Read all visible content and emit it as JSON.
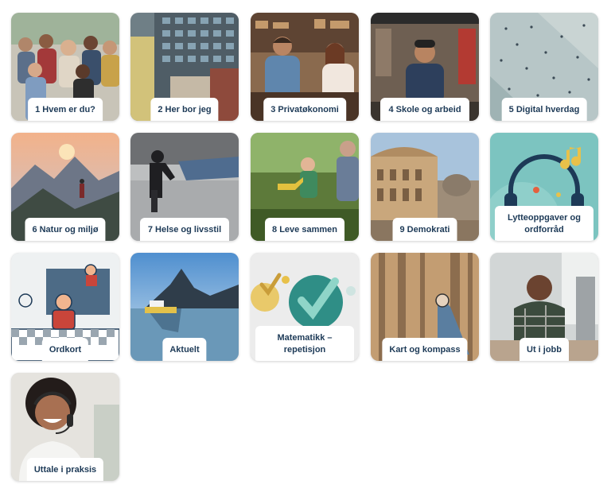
{
  "tiles": [
    {
      "label": "1 Hvem er du?"
    },
    {
      "label": "2 Her bor jeg"
    },
    {
      "label": "3 Privatøkonomi"
    },
    {
      "label": "4 Skole og arbeid"
    },
    {
      "label": "5 Digital hverdag"
    },
    {
      "label": "6 Natur og miljø"
    },
    {
      "label": "7 Helse og livsstil"
    },
    {
      "label": "8 Leve sammen"
    },
    {
      "label": "9 Demokrati"
    },
    {
      "label": "Lytteoppgaver og ordforråd"
    },
    {
      "label": "Ordkort"
    },
    {
      "label": "Aktuelt"
    },
    {
      "label": "Matematikk – repetisjon"
    },
    {
      "label": "Kart og kompass"
    },
    {
      "label": "Ut i jobb"
    },
    {
      "label": "Uttale i praksis"
    }
  ],
  "colors": {
    "label_text": "#1d3a57",
    "teal": "#3fa3a0",
    "yellow": "#e8c14a"
  }
}
